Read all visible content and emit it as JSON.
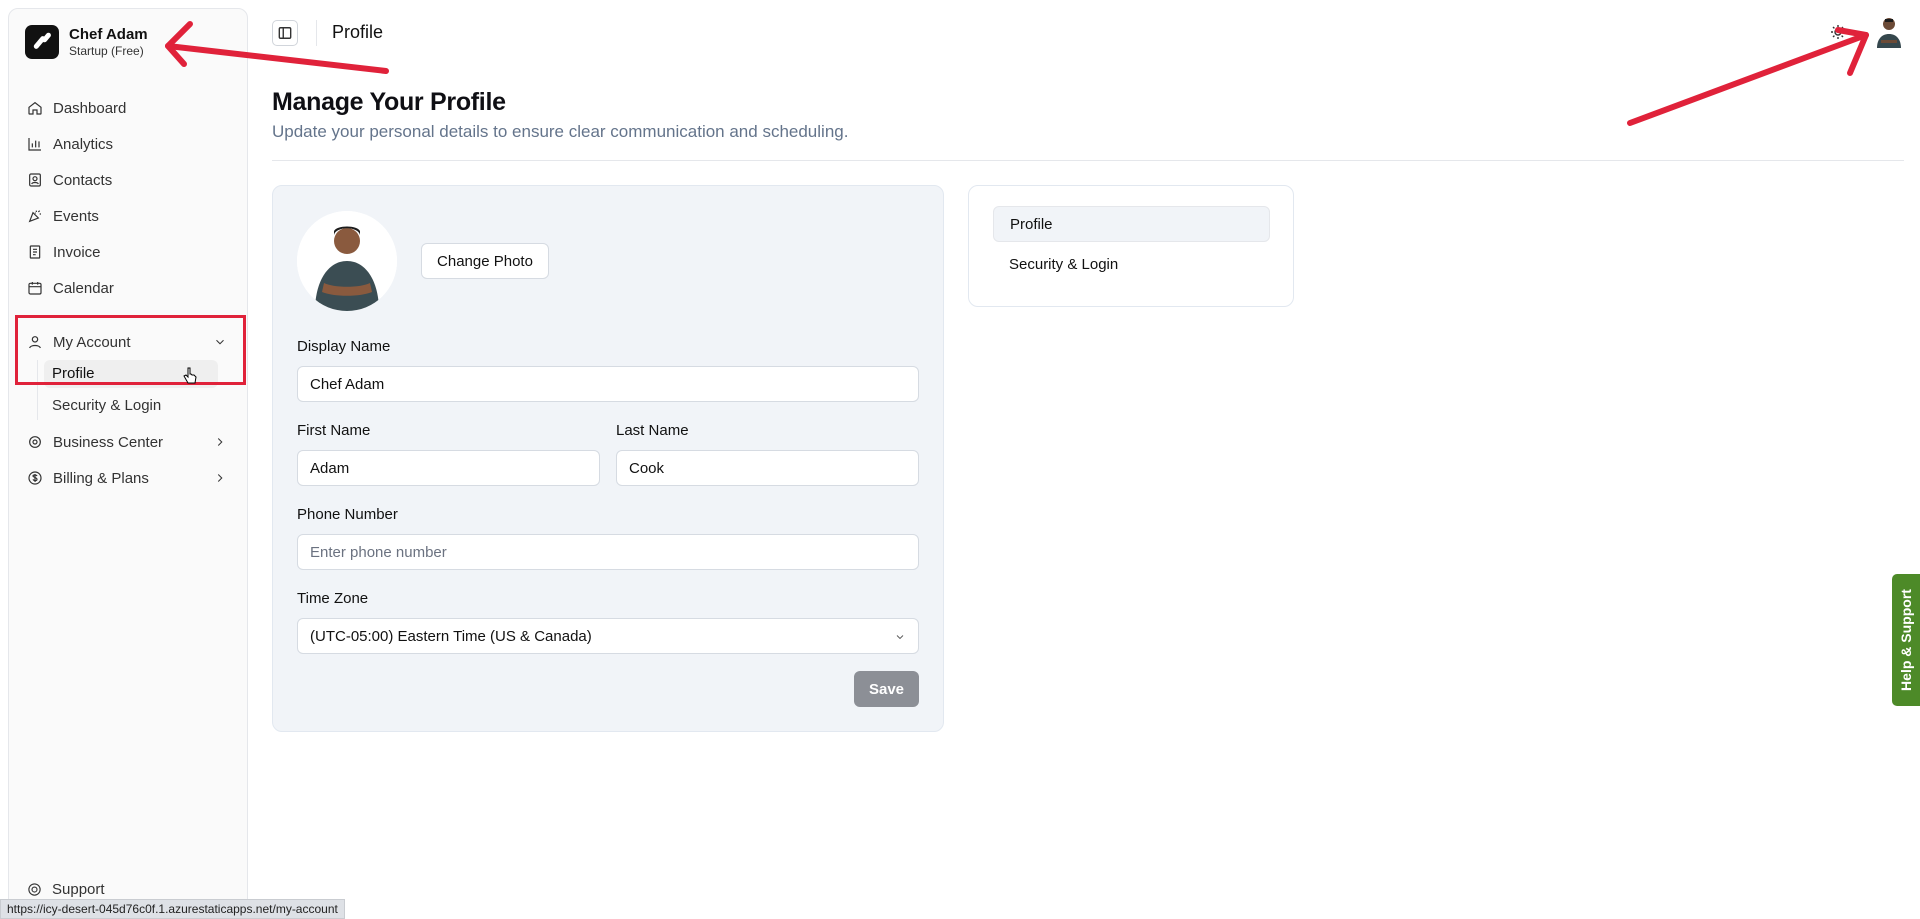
{
  "brand": {
    "name": "Chef Adam",
    "plan": "Startup (Free)"
  },
  "nav": {
    "items": [
      {
        "label": "Dashboard",
        "icon": "home-icon"
      },
      {
        "label": "Analytics",
        "icon": "bar-chart-icon"
      },
      {
        "label": "Contacts",
        "icon": "contact-book-icon"
      },
      {
        "label": "Events",
        "icon": "party-popper-icon"
      },
      {
        "label": "Invoice",
        "icon": "receipt-icon"
      },
      {
        "label": "Calendar",
        "icon": "calendar-icon"
      }
    ],
    "my_account": {
      "label": "My Account",
      "sub": [
        "Profile",
        "Security & Login"
      ]
    },
    "business_center": "Business Center",
    "billing": "Billing & Plans",
    "support": "Support"
  },
  "header": {
    "title": "Profile"
  },
  "page": {
    "title": "Manage Your Profile",
    "subtitle": "Update your personal details to ensure clear communication and scheduling."
  },
  "form": {
    "change_photo": "Change Photo",
    "display_name_label": "Display Name",
    "display_name_value": "Chef Adam",
    "first_name_label": "First Name",
    "first_name_value": "Adam",
    "last_name_label": "Last Name",
    "last_name_value": "Cook",
    "phone_label": "Phone Number",
    "phone_placeholder": "Enter phone number",
    "timezone_label": "Time Zone",
    "timezone_value": "(UTC-05:00) Eastern Time (US & Canada)",
    "save": "Save"
  },
  "side_tabs": [
    "Profile",
    "Security & Login"
  ],
  "help_tab": "Help & Support",
  "status_url": "https://icy-desert-045d76c0f.1.azurestaticapps.net/my-account",
  "colors": {
    "annotation": "#e0223a",
    "help": "#4d8a28",
    "save_disabled": "#8c8f96"
  }
}
